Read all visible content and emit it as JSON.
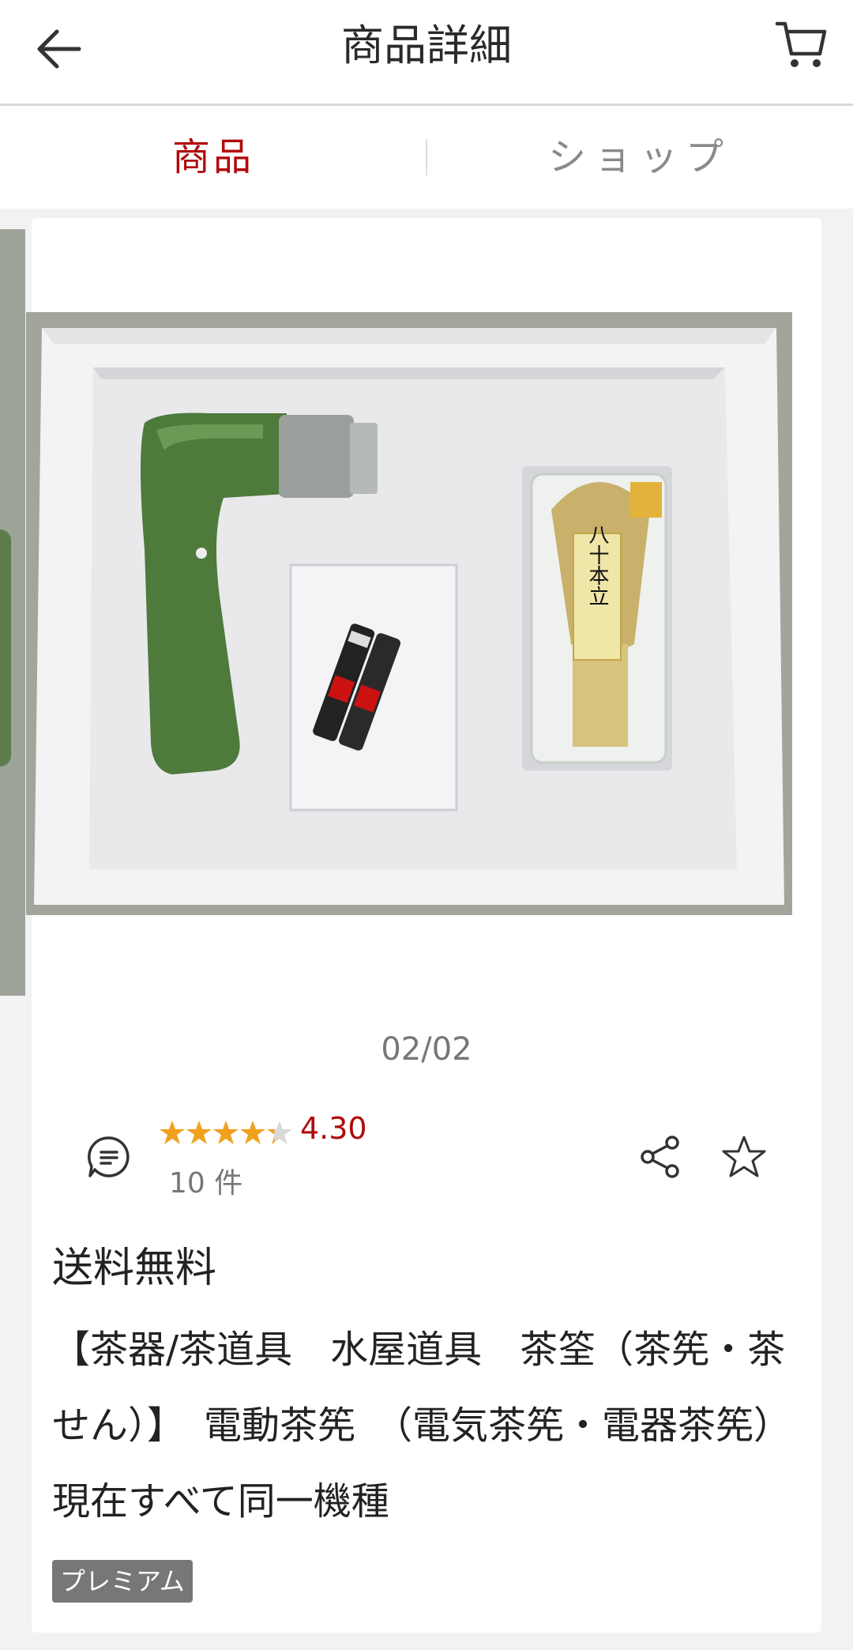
{
  "header": {
    "title": "商品詳細",
    "back_icon": "arrow-left-icon",
    "cart_icon": "cart-icon"
  },
  "tabs": [
    {
      "label": "商品",
      "active": true
    },
    {
      "label": "ショップ",
      "active": false
    }
  ],
  "gallery": {
    "counter": "02/02",
    "box_label": "八十本立"
  },
  "rating": {
    "stars_value": 4.3,
    "value_text": "4.30",
    "count_text": "10 件",
    "star_color": "#f0a11e"
  },
  "shipping": "送料無料",
  "product_title": "【茶器/茶道具　水屋道具　茶筌（茶筅・茶せん）】　電動茶筅　（電気茶筅・電器茶筅）　現在すべて同一機種",
  "badge": "プレミアム",
  "colors": {
    "accent": "#b00b0b",
    "muted": "#8a8a8a"
  }
}
